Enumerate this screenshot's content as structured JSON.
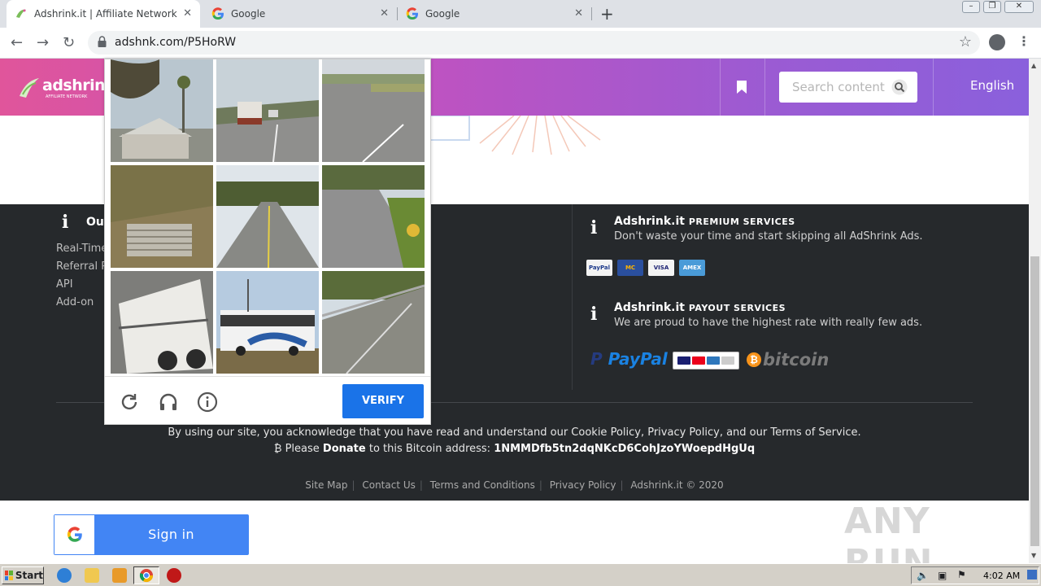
{
  "browser": {
    "tabs": [
      {
        "title": "Adshrink.it | Affiliate Network"
      },
      {
        "title": "Google"
      },
      {
        "title": "Google"
      }
    ],
    "url": "adshnk.com/P5HoRW"
  },
  "header": {
    "logo_text": "adshrink.it",
    "logo_sub": "AFFILIATE NETWORK",
    "search_placeholder": "Search content",
    "language": "English"
  },
  "footer": {
    "col_title": "Ou",
    "links": [
      "Real-Time",
      "Referral P",
      "API",
      "Add-on"
    ],
    "premium": {
      "brand": "Adshrink.it",
      "label": "PREMIUM SERVICES",
      "desc": "Don't waste your time and start skipping all AdShrink Ads."
    },
    "payout": {
      "brand": "Adshrink.it",
      "label": "PAYOUT SERVICES",
      "desc": "We are proud to have the highest rate with really few ads."
    },
    "card_labels": [
      "PayPal",
      "MC",
      "VISA",
      "AMEX"
    ],
    "paypal_text": "PayPal",
    "bitcoin_text": "bitcoin",
    "legal": "By using our site, you acknowledge that you have read and understand our Cookie Policy, Privacy Policy, and our Terms of Service.",
    "donate_prefix": "Please",
    "donate_bold": "Donate",
    "donate_mid": "to this Bitcoin address:",
    "btc_address": "1NMMDfb5tn2dqNKcD6CohJzoYWoepdHgUq",
    "bottom_links": [
      "Site Map",
      "Contact Us",
      "Terms and Conditions",
      "Privacy Policy",
      "Adshrink.it © 2020"
    ]
  },
  "captcha": {
    "verify_label": "VERIFY"
  },
  "signin": {
    "label": "Sign in"
  },
  "watermark": "ANY RUN",
  "taskbar": {
    "start_label": "Start",
    "clock": "4:02 AM"
  }
}
